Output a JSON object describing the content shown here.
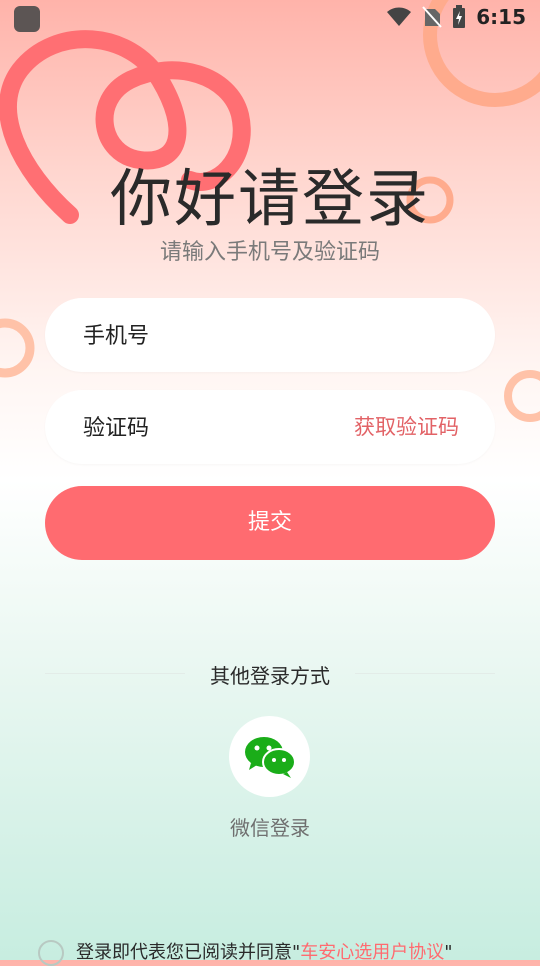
{
  "status_bar": {
    "time": "6:15"
  },
  "login": {
    "title": "你好请登录",
    "subtitle": "请输入手机号及验证码",
    "phone_placeholder": "手机号",
    "code_placeholder": "验证码",
    "get_code_label": "获取验证码",
    "submit_label": "提交"
  },
  "other_login": {
    "label": "其他登录方式",
    "wechat_label": "微信登录"
  },
  "agreement": {
    "text": "登录即代表您已阅读并同意\"",
    "link": "车安心选用户协议",
    "close": "\""
  },
  "colors": {
    "accent": "#ff6b70",
    "wechat_green": "#1aad19"
  }
}
